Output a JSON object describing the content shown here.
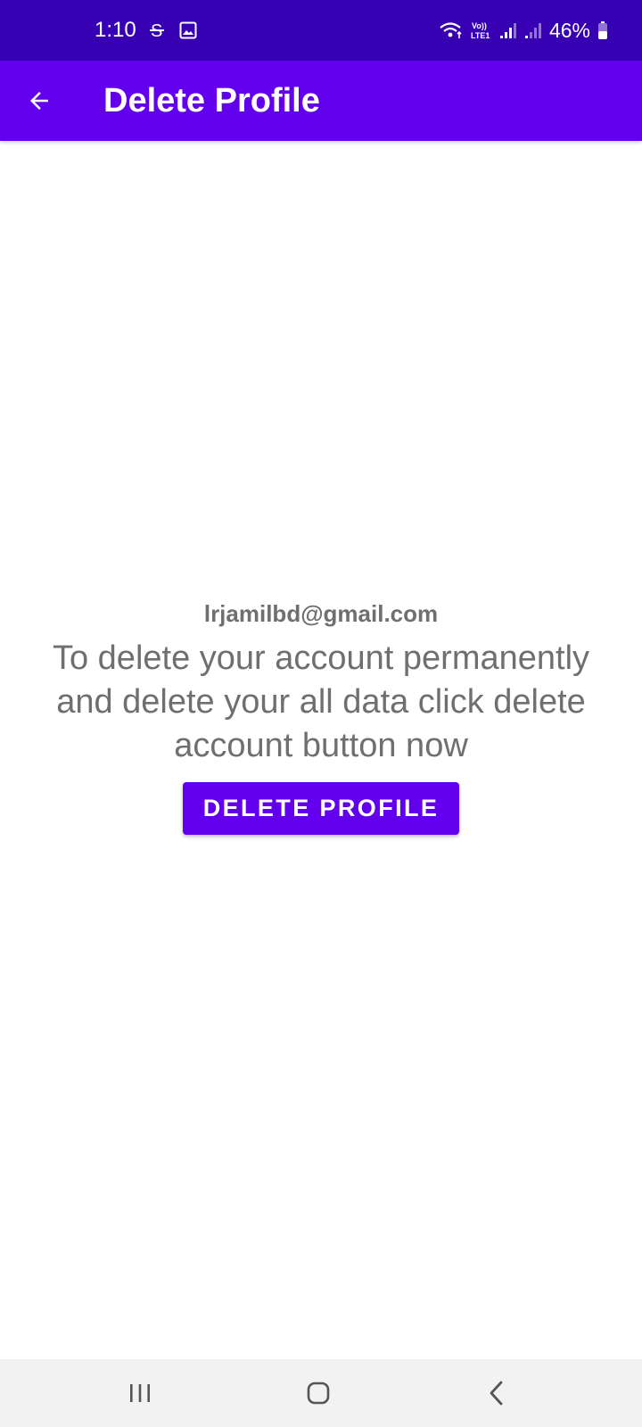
{
  "status_bar": {
    "time": "1:10",
    "battery": "46%",
    "icons": [
      "s-icon",
      "gallery-icon",
      "wifi-icon",
      "volte-icon",
      "signal-icon",
      "signal-icon-2",
      "battery-icon"
    ],
    "volte_label": "Vo))\nLTE1"
  },
  "app_bar": {
    "title": "Delete Profile",
    "back_icon": "arrow-back-icon",
    "background": "#6200ee"
  },
  "content": {
    "email": "lrjamilbd@gmail.com",
    "message": "To delete your account permanently and delete your all data click delete account button now",
    "delete_button_label": "DELETE PROFILE"
  },
  "nav_bar": {
    "recents_icon": "recents-icon",
    "home_icon": "home-icon",
    "back_icon": "back-icon"
  },
  "colors": {
    "status_bar": "#3700b3",
    "primary": "#6200ee",
    "text_secondary": "#6f6f6f",
    "nav_bar": "#f2f2f2"
  }
}
